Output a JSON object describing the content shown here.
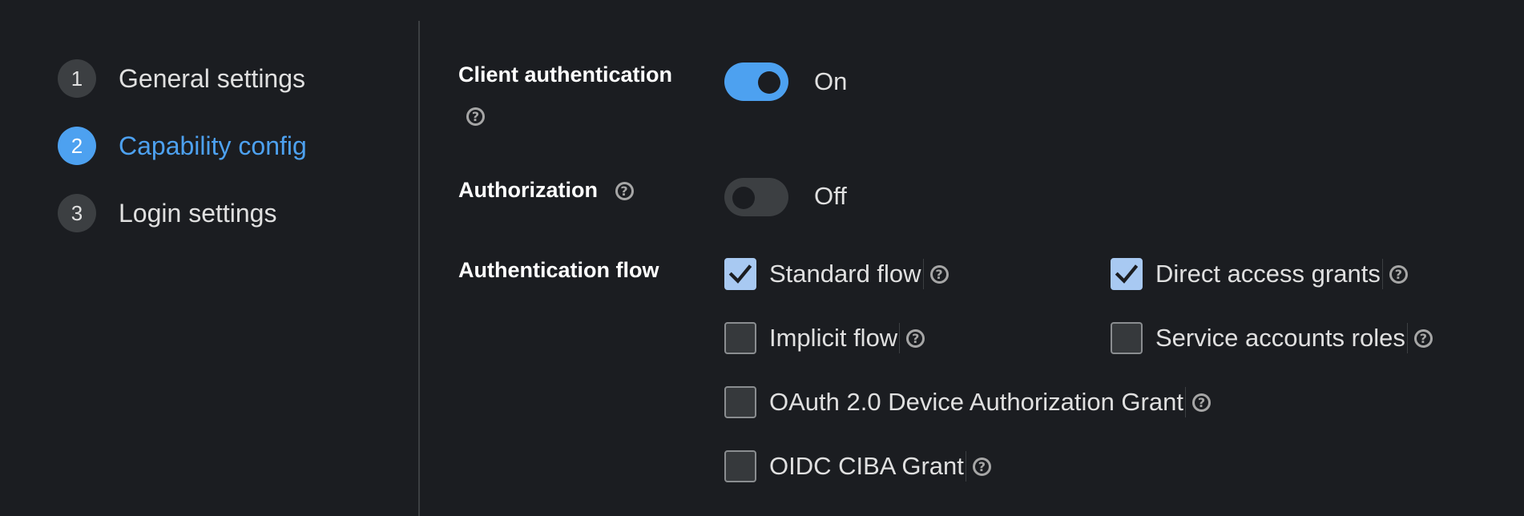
{
  "wizard": {
    "steps": [
      {
        "num": "1",
        "label": "General settings"
      },
      {
        "num": "2",
        "label": "Capability config"
      },
      {
        "num": "3",
        "label": "Login settings"
      }
    ],
    "active_step": 2
  },
  "form": {
    "client_authentication": {
      "label": "Client authentication",
      "state": "On",
      "enabled": true
    },
    "authorization": {
      "label": "Authorization",
      "state": "Off",
      "enabled": false
    },
    "authentication_flow": {
      "label": "Authentication flow",
      "options": [
        {
          "label": "Standard flow",
          "checked": true
        },
        {
          "label": "Direct access grants",
          "checked": true
        },
        {
          "label": "Implicit flow",
          "checked": false
        },
        {
          "label": "Service accounts roles",
          "checked": false
        },
        {
          "label": "OAuth 2.0 Device Authorization Grant",
          "checked": false
        },
        {
          "label": "OIDC CIBA Grant",
          "checked": false
        }
      ]
    }
  },
  "icons": {
    "help": "question-circle-icon",
    "check": "checkmark-icon"
  },
  "colors": {
    "accent": "#4da1f0",
    "background": "#1b1d21",
    "checkbox_checked": "#a8c9f2"
  }
}
